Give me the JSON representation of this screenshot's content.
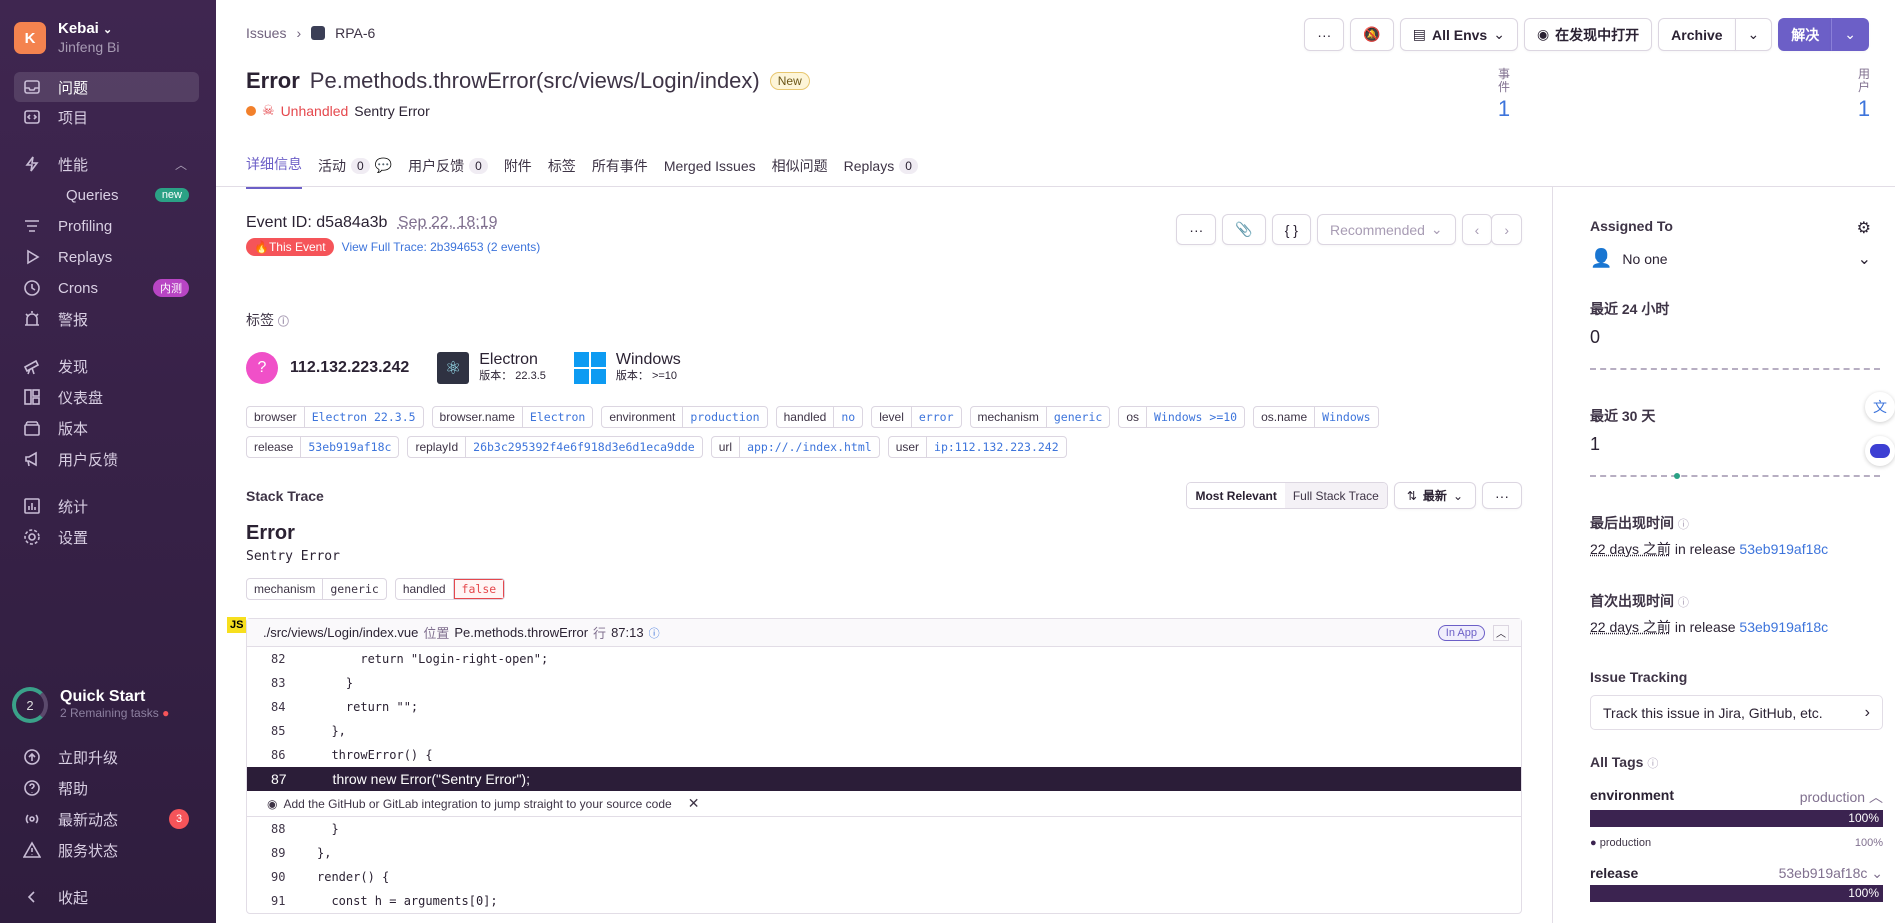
{
  "sidebar": {
    "org_name": "Kebai",
    "org_initial": "K",
    "user_name": "Jinfeng Bi",
    "items": [
      {
        "label": "问题"
      },
      {
        "label": "项目"
      },
      {
        "label": "性能"
      },
      {
        "label": "Queries",
        "badge": "new"
      },
      {
        "label": "Profiling"
      },
      {
        "label": "Replays"
      },
      {
        "label": "Crons",
        "badge": "内测"
      },
      {
        "label": "警报"
      },
      {
        "label": "发现"
      },
      {
        "label": "仪表盘"
      },
      {
        "label": "版本"
      },
      {
        "label": "用户反馈"
      },
      {
        "label": "统计"
      },
      {
        "label": "设置"
      }
    ],
    "quick_start": {
      "count": "2",
      "title": "Quick Start",
      "subtitle": "2 Remaining tasks"
    },
    "bottom": [
      {
        "label": "立即升级"
      },
      {
        "label": "帮助"
      },
      {
        "label": "最新动态",
        "badge": "3"
      },
      {
        "label": "服务状态"
      },
      {
        "label": "收起"
      }
    ]
  },
  "breadcrumb": {
    "root": "Issues",
    "current": "RPA-6"
  },
  "toolbar": {
    "more": "···",
    "envs": "All Envs",
    "open_in_discover": "在发现中打开",
    "archive": "Archive",
    "resolve": "解决"
  },
  "issue": {
    "type": "Error",
    "function": "Pe.methods.throwError(src/views/Login/index)",
    "new_tag": "New",
    "unhandled": "Unhandled",
    "message": "Sentry Error",
    "events_label": "事件",
    "events_value": "1",
    "users_label": "用户",
    "users_value": "1"
  },
  "tabs": [
    {
      "label": "详细信息"
    },
    {
      "label": "活动",
      "count": "0"
    },
    {
      "label": "用户反馈",
      "count": "0"
    },
    {
      "label": "附件"
    },
    {
      "label": "标签"
    },
    {
      "label": "所有事件"
    },
    {
      "label": "Merged Issues"
    },
    {
      "label": "相似问题"
    },
    {
      "label": "Replays",
      "count": "0"
    }
  ],
  "event": {
    "id_label": "Event ID:",
    "id": "d5a84a3b",
    "date": "Sep 22, 18:19",
    "this_event": "This Event",
    "trace_link": "View Full Trace: 2b394653 (2 events)",
    "recommended": "Recommended"
  },
  "tags_section": {
    "title": "标签",
    "highlights": [
      {
        "title": "112.132.223.242"
      },
      {
        "title": "Electron",
        "version_label": "版本：",
        "version": "22.3.5"
      },
      {
        "title": "Windows",
        "version_label": "版本：",
        "version": ">=10"
      }
    ],
    "tags": [
      {
        "k": "browser",
        "v": "Electron 22.3.5"
      },
      {
        "k": "browser.name",
        "v": "Electron"
      },
      {
        "k": "environment",
        "v": "production"
      },
      {
        "k": "handled",
        "v": "no"
      },
      {
        "k": "level",
        "v": "error"
      },
      {
        "k": "mechanism",
        "v": "generic"
      },
      {
        "k": "os",
        "v": "Windows >=10"
      },
      {
        "k": "os.name",
        "v": "Windows"
      },
      {
        "k": "release",
        "v": "53eb919af18c"
      },
      {
        "k": "replayId",
        "v": "26b3c295392f4e6f918d3e6d1eca9dde"
      },
      {
        "k": "url",
        "v": "app://./index.html"
      },
      {
        "k": "user",
        "v": "ip:112.132.223.242"
      }
    ]
  },
  "stack": {
    "title": "Stack Trace",
    "most_relevant": "Most Relevant",
    "full_stack": "Full Stack Trace",
    "sort": "最新",
    "error_type": "Error",
    "error_value": "Sentry Error",
    "mech_k": "mechanism",
    "mech_v": "generic",
    "handled_k": "handled",
    "handled_v": "false",
    "frame_file": "./src/views/Login/index.vue",
    "frame_at": "位置",
    "frame_fn": "Pe.methods.throwError",
    "frame_line_label": "行",
    "frame_line": "87:13",
    "in_app": "In App",
    "js": "JS",
    "lines_before": [
      {
        "n": "82",
        "t": "      return \"Login-right-open\";"
      },
      {
        "n": "83",
        "t": "    }"
      },
      {
        "n": "84",
        "t": "    return \"\";"
      },
      {
        "n": "85",
        "t": "  },"
      },
      {
        "n": "86",
        "t": "  throwError() {"
      }
    ],
    "highlight": {
      "n": "87",
      "t": "    throw new Error(\"Sentry Error\");"
    },
    "integration_note": "Add the GitHub or GitLab integration to jump straight to your source code",
    "lines_after": [
      {
        "n": "88",
        "t": "  }"
      },
      {
        "n": "89",
        "t": "},"
      },
      {
        "n": "90",
        "t": "render() {"
      },
      {
        "n": "91",
        "t": "  const h = arguments[0];"
      }
    ]
  },
  "side": {
    "assigned_to": "Assigned To",
    "no_one": "No one",
    "last24_label": "最近 24 小时",
    "last24_value": "0",
    "last30_label": "最近 30 天",
    "last30_value": "1",
    "last_seen_label": "最后出现时间",
    "last_seen_ago": "22 days 之前",
    "in_release": "in release",
    "last_seen_release": "53eb919af18c",
    "first_seen_label": "首次出现时间",
    "first_seen_ago": "22 days 之前",
    "first_seen_release": "53eb919af18c",
    "tracking_label": "Issue Tracking",
    "tracking_text": "Track this issue in Jira, GitHub, etc.",
    "all_tags": "All Tags",
    "env_key": "environment",
    "env_val": "production",
    "env_pct": "100%",
    "env_item": "production",
    "env_item_pct": "100%",
    "release_key": "release",
    "release_val": "53eb919af18c",
    "release_pct": "100%"
  }
}
